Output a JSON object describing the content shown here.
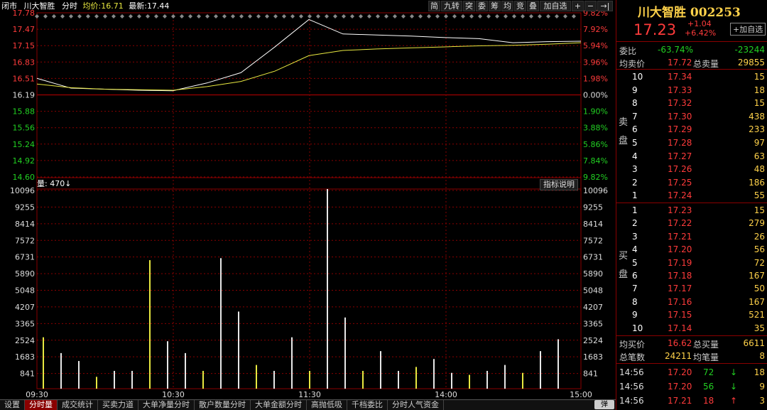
{
  "header": {
    "status": "闭市",
    "name": "川大智胜",
    "mode": "分时",
    "avg_label": "均价:",
    "avg_value": "16.71",
    "last_label": "最新:",
    "last_value": "17.44"
  },
  "toolbar": {
    "b1": "简",
    "b2": "九转",
    "b3": "突",
    "b4": "委",
    "b5": "筹",
    "b6": "均",
    "b7": "竞",
    "b8": "叠",
    "b9": "加自选",
    "b10": "+",
    "b11": "−",
    "b12": "→|"
  },
  "volume": {
    "label": "量: 470↓",
    "help": "指标说明"
  },
  "price_axis": {
    "left": [
      "17.78",
      "17.47",
      "17.15",
      "16.83",
      "16.51",
      "16.19",
      "15.88",
      "15.56",
      "15.24",
      "14.92",
      "14.60"
    ],
    "right": [
      "9.82%",
      "7.92%",
      "5.94%",
      "3.96%",
      "1.98%",
      "0.00%",
      "1.90%",
      "3.88%",
      "5.86%",
      "7.84%",
      "9.82%"
    ]
  },
  "vol_axis": [
    "10096",
    "9255",
    "8414",
    "7572",
    "6731",
    "5890",
    "5048",
    "4207",
    "3365",
    "2524",
    "1683",
    "841"
  ],
  "time_axis": [
    "09:30",
    "10:30",
    "11:30",
    "14:00",
    "15:00"
  ],
  "tabs": [
    "设置",
    "分时量",
    "成交统计",
    "买卖力道",
    "大单净量分时",
    "散户数量分时",
    "大单金额分时",
    "高抛低吸",
    "千档委比",
    "分时人气资金"
  ],
  "colors": {
    "up": "#ff3b3b",
    "down": "#22d022",
    "grid": "#8a0000",
    "price": "#ffffff",
    "avg": "#e8e840"
  },
  "chart_data": {
    "type": "line",
    "x": [
      "09:30",
      "09:45",
      "10:00",
      "10:15",
      "10:30",
      "10:45",
      "11:00",
      "11:15",
      "11:30",
      "13:15",
      "13:30",
      "13:45",
      "14:00",
      "14:15",
      "14:30",
      "14:45",
      "15:00"
    ],
    "series": [
      {
        "values": [
          16.51,
          16.32,
          16.3,
          16.28,
          16.27,
          16.42,
          16.62,
          17.12,
          17.65,
          17.37,
          17.35,
          17.33,
          17.3,
          17.28,
          17.2,
          17.22,
          17.23
        ]
      },
      {
        "values": [
          16.4,
          16.33,
          16.3,
          16.29,
          16.28,
          16.35,
          16.45,
          16.65,
          16.95,
          17.05,
          17.08,
          17.1,
          17.12,
          17.14,
          17.15,
          17.17,
          17.2
        ]
      }
    ],
    "ylim": [
      14.6,
      17.78
    ],
    "prev_close": 16.19,
    "volume": {
      "values": [
        2600,
        1800,
        1400,
        600,
        900,
        900,
        6500,
        2400,
        1800,
        900,
        6600,
        3900,
        1200,
        900,
        2600,
        900,
        10096,
        3600,
        900,
        1900,
        900,
        1100,
        1500,
        800,
        700,
        900,
        1200,
        800,
        1900,
        2500
      ],
      "ylim": [
        0,
        10096
      ]
    }
  },
  "right": {
    "title": "川大智胜 002253",
    "price": "17.23",
    "chg": "+1.04",
    "pct": "+6.42%",
    "add": "+加自选",
    "wb_l": "委比",
    "wb": "-63.74%",
    "wc": "-23244",
    "sa_l": "均卖价",
    "sa": "17.72",
    "sq_l": "总卖量",
    "sq": "29855",
    "sell_mark": "卖盘",
    "buy_mark": "买盘",
    "sell": [
      [
        "10",
        "17.34",
        "15"
      ],
      [
        "9",
        "17.33",
        "18"
      ],
      [
        "8",
        "17.32",
        "15"
      ],
      [
        "7",
        "17.30",
        "438"
      ],
      [
        "6",
        "17.29",
        "233"
      ],
      [
        "5",
        "17.28",
        "97"
      ],
      [
        "4",
        "17.27",
        "63"
      ],
      [
        "3",
        "17.26",
        "48"
      ],
      [
        "2",
        "17.25",
        "186"
      ],
      [
        "1",
        "17.24",
        "55"
      ]
    ],
    "buy": [
      [
        "1",
        "17.23",
        "15"
      ],
      [
        "2",
        "17.22",
        "279"
      ],
      [
        "3",
        "17.21",
        "26"
      ],
      [
        "4",
        "17.20",
        "56"
      ],
      [
        "5",
        "17.19",
        "72"
      ],
      [
        "6",
        "17.18",
        "167"
      ],
      [
        "7",
        "17.17",
        "50"
      ],
      [
        "8",
        "17.16",
        "167"
      ],
      [
        "9",
        "17.15",
        "521"
      ],
      [
        "10",
        "17.14",
        "35"
      ]
    ],
    "ba_l": "均买价",
    "ba": "16.62",
    "bq_l": "总买量",
    "bq": "6611",
    "tn_l": "总笔数",
    "tn": "24211",
    "ap_l": "均笔量",
    "ap": "8",
    "ticks": [
      [
        "14:56",
        "17.20",
        "72",
        "↓",
        "18"
      ],
      [
        "14:56",
        "17.20",
        "56",
        "↓",
        "9"
      ],
      [
        "14:56",
        "17.21",
        "18",
        "↑",
        "3"
      ]
    ],
    "pager": "弹"
  }
}
